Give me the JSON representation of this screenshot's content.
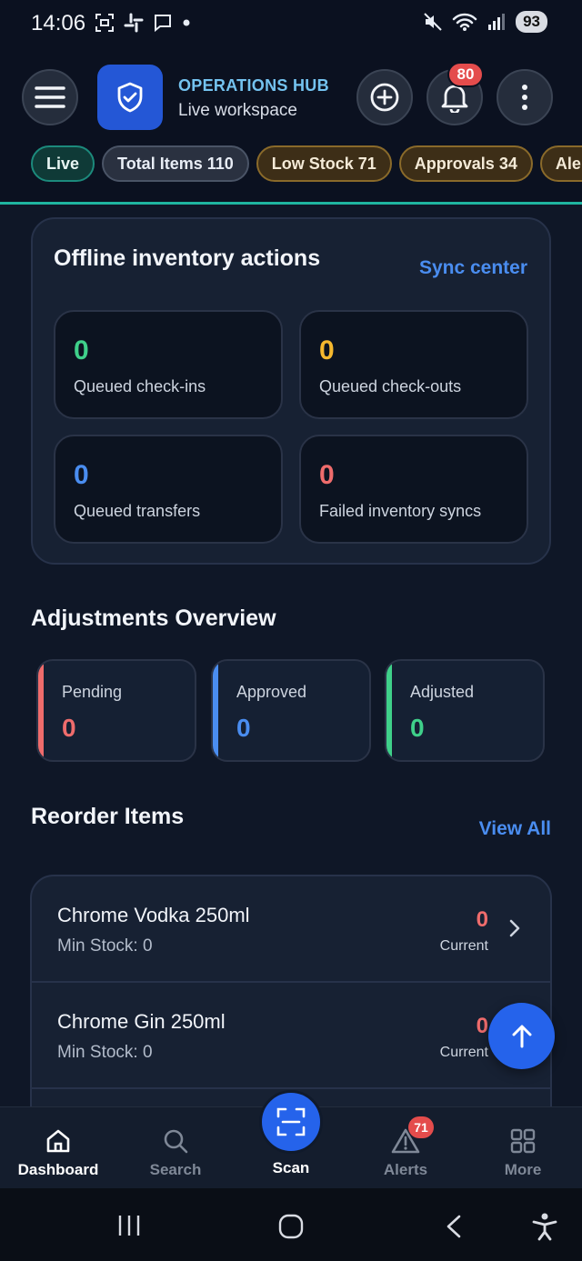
{
  "status_bar": {
    "time": "14:06",
    "battery": "93"
  },
  "header": {
    "title": "OPERATIONS HUB",
    "subtitle": "Live workspace",
    "notification_count": "80"
  },
  "chips": [
    {
      "label": "Live"
    },
    {
      "label": "Total Items 110"
    },
    {
      "label": "Low Stock 71"
    },
    {
      "label": "Approvals 34"
    },
    {
      "label": "Alerts"
    }
  ],
  "offline": {
    "title": "Offline inventory actions",
    "link": "Sync center",
    "tiles": [
      {
        "value": "0",
        "label": "Queued check-ins",
        "color": "#3fd08a"
      },
      {
        "value": "0",
        "label": "Queued check-outs",
        "color": "#f5b82e"
      },
      {
        "value": "0",
        "label": "Queued transfers",
        "color": "#4a8df0"
      },
      {
        "value": "0",
        "label": "Failed inventory syncs",
        "color": "#ef6c6c"
      }
    ]
  },
  "adjustments": {
    "title": "Adjustments Overview",
    "tiles": [
      {
        "label": "Pending",
        "value": "0",
        "color": "#ef6c6c"
      },
      {
        "label": "Approved",
        "value": "0",
        "color": "#4a8df0"
      },
      {
        "label": "Adjusted",
        "value": "0",
        "color": "#3fd08a"
      }
    ]
  },
  "reorder": {
    "title": "Reorder Items",
    "link": "View All",
    "items": [
      {
        "name": "Chrome Vodka 250ml",
        "min": "Min Stock: 0",
        "current": "0",
        "current_label": "Current"
      },
      {
        "name": "Chrome Gin 250ml",
        "min": "Min Stock: 0",
        "current": "0",
        "current_label": "Current"
      }
    ]
  },
  "bottom_nav": {
    "dashboard": "Dashboard",
    "search": "Search",
    "scan": "Scan",
    "alerts": "Alerts",
    "alerts_count": "71",
    "more": "More"
  },
  "colors": {
    "accent": "#2563eb",
    "teal_line": "#1fb5a0",
    "background": "#0f1727"
  }
}
